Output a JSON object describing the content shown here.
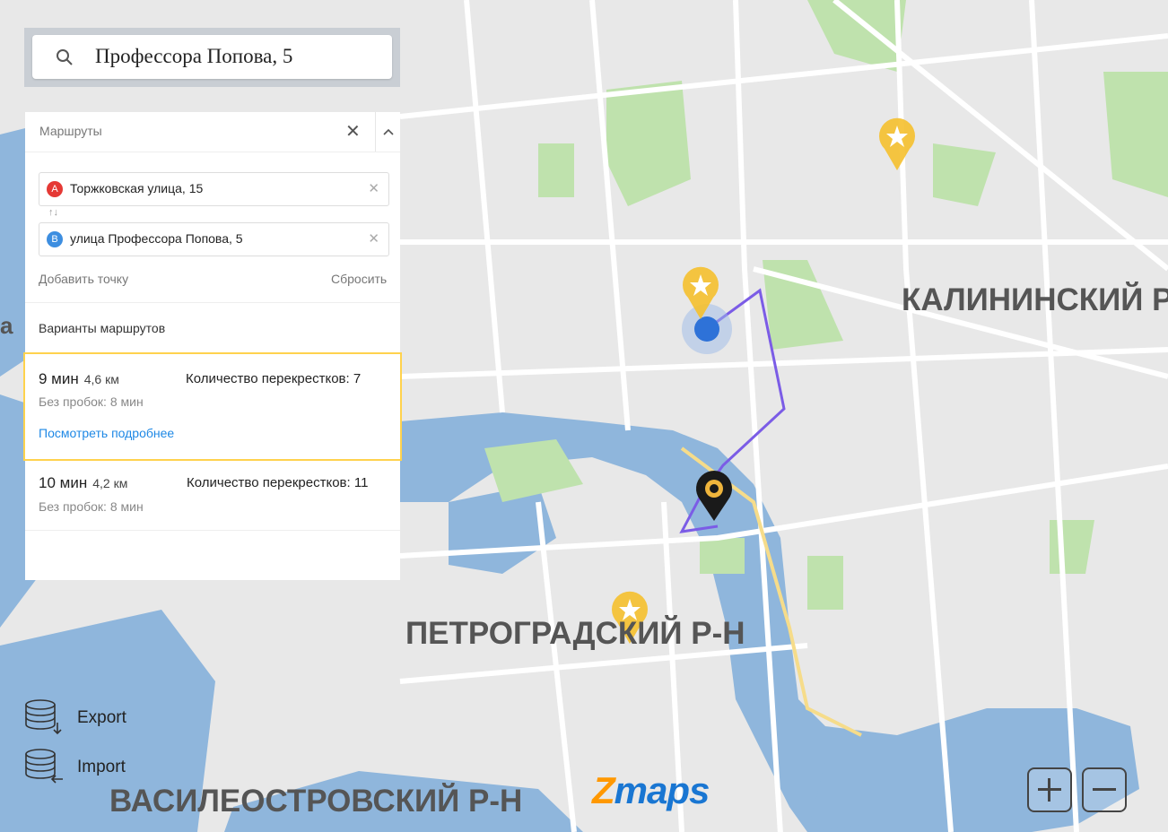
{
  "search": {
    "query": "Профессора Попова, 5"
  },
  "routes_panel": {
    "title": "Маршруты",
    "point_a": {
      "marker": "A",
      "address": "Торжковская улица, 15"
    },
    "point_b": {
      "marker": "B",
      "address": "улица Профессора Попова, 5"
    },
    "swap_symbol": "↑↓",
    "add_point": "Добавить точку",
    "reset": "Сбросить",
    "variants_label": "Варианты маршрутов",
    "variants": [
      {
        "time": "9 мин",
        "distance": "4,6 км",
        "crossings": "Количество перекрестков: 7",
        "no_traffic": "Без пробок: 8 мин",
        "details_link": "Посмотреть подробнее",
        "selected": true
      },
      {
        "time": "10 мин",
        "distance": "4,2 км",
        "crossings": "Количество перекрестков: 11",
        "no_traffic": "Без пробок: 8 мин",
        "selected": false
      }
    ]
  },
  "map_labels": {
    "kalininsky": "КАЛИНИНСКИЙ Р-",
    "petrogradsky": "ПЕТРОГРАДСКИЙ Р-Н",
    "vasileostrovsky": "ВАСИЛЕОСТРОВСКИЙ Р-Н",
    "edge": "а"
  },
  "actions": {
    "export": "Export",
    "import": "Import"
  },
  "logo": {
    "z": "Z",
    "rest": "maps"
  },
  "icons": [
    "search-icon",
    "close-icon",
    "chevron-up-icon",
    "database-export-icon",
    "database-import-icon",
    "zoom-in-icon",
    "zoom-out-icon",
    "star-pin-icon",
    "location-pin-icon"
  ],
  "colors": {
    "route": "#7b5ce6",
    "water": "#7eaed8",
    "park": "#b8e0a6",
    "star": "#f5c02e",
    "accent_link": "#1e88e5",
    "selected_border": "#ffd24d"
  }
}
